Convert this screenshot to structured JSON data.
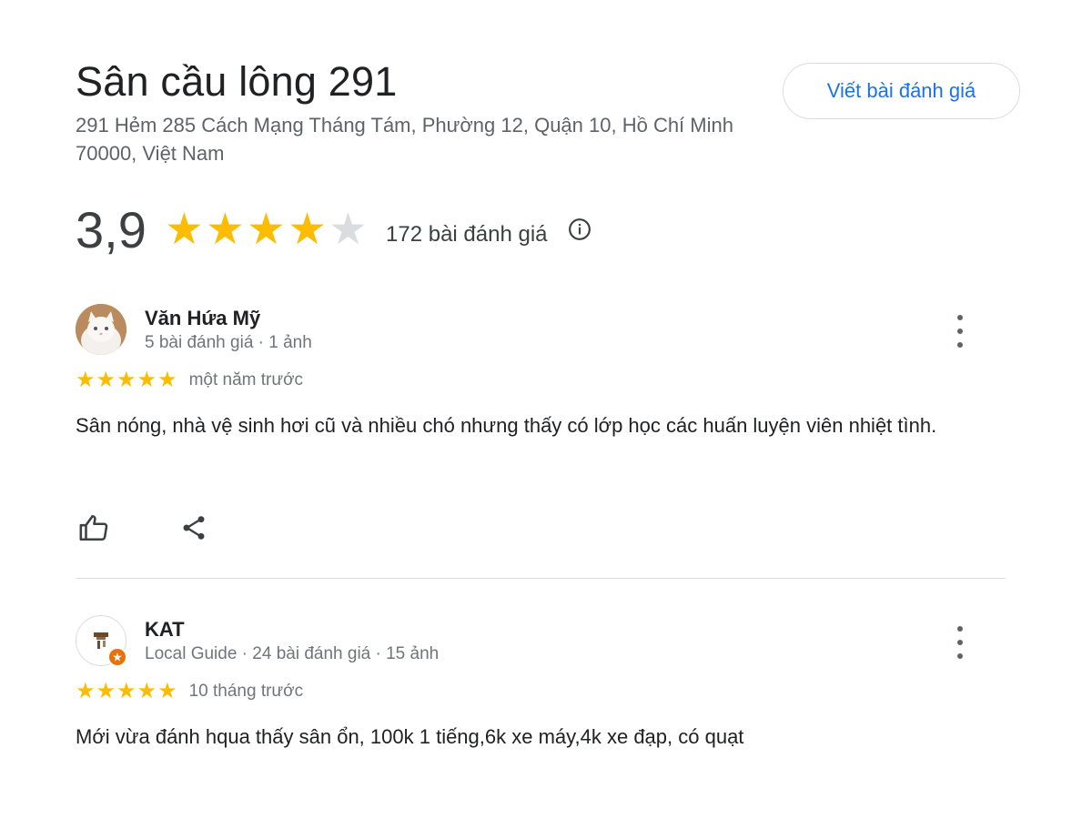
{
  "place": {
    "title": "Sân cầu lông 291",
    "address": "291 Hẻm 285 Cách Mạng Tháng Tám, Phường 12, Quận 10, Hồ Chí Minh 70000, Việt Nam",
    "write_review_label": "Viết bài đánh giá"
  },
  "rating": {
    "value": "3,9",
    "stars": 3.9,
    "review_count_label": "172 bài đánh giá",
    "info_icon": "info-icon"
  },
  "colors": {
    "star": "#fbbc04",
    "star_empty": "#dadce0",
    "link": "#1a73e8"
  },
  "reviews": [
    {
      "name": "Văn Hứa Mỹ",
      "subtitle": "5 bài đánh giá · 1 ảnh",
      "stars": 5,
      "time": "một năm trước",
      "text": "Sân nóng, nhà vệ sinh hơi cũ và nhiều chó nhưng thấy có lớp học các huấn luyện viên nhiệt tình."
    },
    {
      "name": "KAT",
      "subtitle": "Local Guide · 24 bài đánh giá · 15 ảnh",
      "stars": 5,
      "time": "10 tháng trước",
      "text": "Mới vừa đánh hqua thấy sân ổn, 100k 1 tiếng,6k xe máy,4k xe đạp, có quạt"
    }
  ],
  "actions": {
    "like_icon": "thumbs-up-icon",
    "share_icon": "share-icon",
    "more_icon": "more-vert-icon"
  }
}
